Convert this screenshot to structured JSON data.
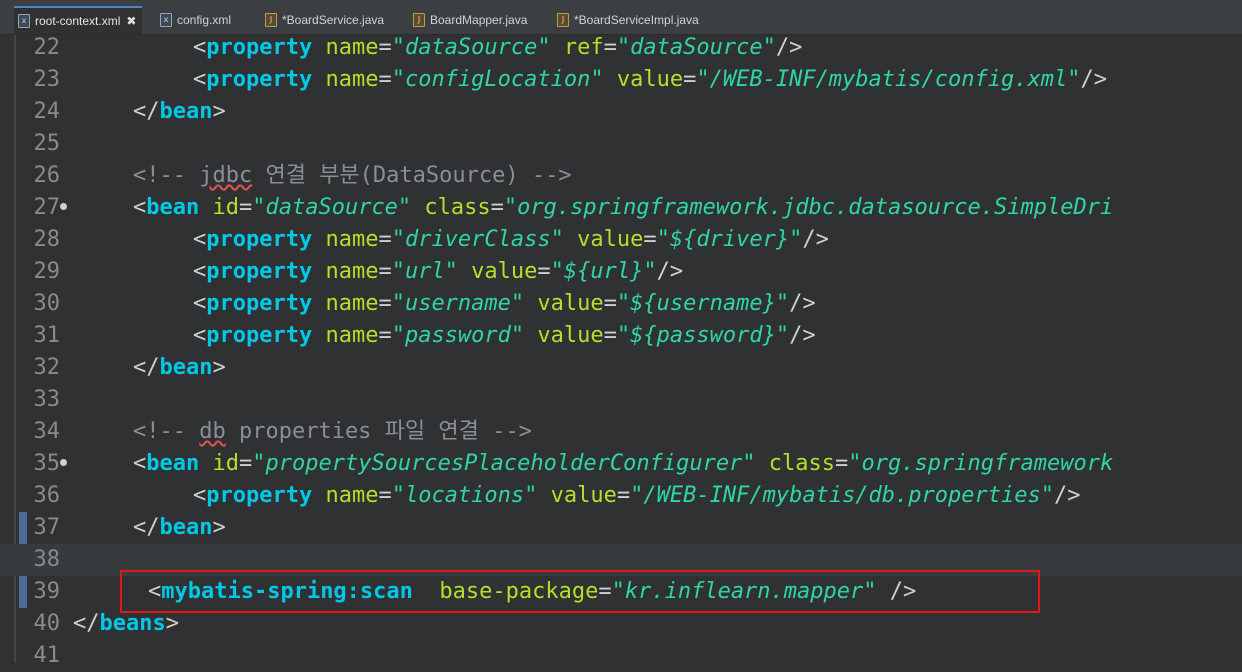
{
  "tabs": [
    {
      "label": "root-context.xml",
      "type": "xml",
      "active": true,
      "close": "✖"
    },
    {
      "label": "config.xml",
      "type": "xml"
    },
    {
      "label": "*BoardService.java",
      "type": "java"
    },
    {
      "label": "BoardMapper.java",
      "type": "java"
    },
    {
      "label": "*BoardServiceImpl.java",
      "type": "java"
    }
  ],
  "line_numbers": [
    "22",
    "23",
    "24",
    "25",
    "26",
    "27",
    "28",
    "29",
    "30",
    "31",
    "32",
    "33",
    "34",
    "35",
    "36",
    "37",
    "38",
    "39",
    "40",
    "41"
  ],
  "code": {
    "l22": {
      "p1": "<",
      "t": "property",
      "a1": " name",
      "e1": "=",
      "v1": "\"dataSource\"",
      "a2": " ref",
      "e2": "=",
      "v2": "\"dataSource\"",
      "p2": "/>"
    },
    "l23": {
      "p1": "<",
      "t": "property",
      "a1": " name",
      "e1": "=",
      "v1": "\"configLocation\"",
      "a2": " value",
      "e2": "=",
      "v2": "\"/WEB-INF/mybatis/config.xml\"",
      "p2": "/>"
    },
    "l24": {
      "p1": "</",
      "t": "bean",
      "p2": ">"
    },
    "l26": {
      "c1": "<!-- ",
      "sq": "jdbc",
      "c2": " 연결 부분(DataSource) -->"
    },
    "l27": {
      "p1": "<",
      "t": "bean",
      "a1": " id",
      "e1": "=",
      "v1": "\"dataSource\"",
      "a2": " class",
      "e2": "=",
      "v2": "\"org.springframework.jdbc.datasource.SimpleDri"
    },
    "l28": {
      "p1": "<",
      "t": "property",
      "a1": " name",
      "e1": "=",
      "v1": "\"driverClass\"",
      "a2": " value",
      "e2": "=",
      "v2": "\"${driver}\"",
      "p2": "/>"
    },
    "l29": {
      "p1": "<",
      "t": "property",
      "a1": " name",
      "e1": "=",
      "v1": "\"url\"",
      "a2": " value",
      "e2": "=",
      "v2": "\"${url}\"",
      "p2": "/>"
    },
    "l30": {
      "p1": "<",
      "t": "property",
      "a1": " name",
      "e1": "=",
      "v1": "\"username\"",
      "a2": " value",
      "e2": "=",
      "v2": "\"${username}\"",
      "p2": "/>"
    },
    "l31": {
      "p1": "<",
      "t": "property",
      "a1": " name",
      "e1": "=",
      "v1": "\"password\"",
      "a2": " value",
      "e2": "=",
      "v2": "\"${password}\"",
      "p2": "/>"
    },
    "l32": {
      "p1": "</",
      "t": "bean",
      "p2": ">"
    },
    "l34": {
      "c1": "<!-- ",
      "sq": "db",
      "c2": " properties 파일 연결 -->"
    },
    "l35": {
      "p1": "<",
      "t": "bean",
      "a1": " id",
      "e1": "=",
      "v1": "\"propertySourcesPlaceholderConfigurer\"",
      "a2": " class",
      "e2": "=",
      "v2": "\"org.springframework"
    },
    "l36": {
      "p1": "<",
      "t": "property",
      "a1": " name",
      "e1": "=",
      "v1": "\"locations\"",
      "a2": " value",
      "e2": "=",
      "v2": "\"/WEB-INF/mybatis/db.properties\"",
      "p2": "/>"
    },
    "l37": {
      "p1": "</",
      "t": "bean",
      "p2": ">"
    },
    "l39": {
      "p1": "<",
      "t": "mybatis-spring:scan",
      "a1": "  base-package",
      "e1": "=",
      "v1": "\"kr.inflearn.mapper\"",
      "p2": " />"
    },
    "l40": {
      "p1": "</",
      "t": "beans",
      "p2": ">"
    }
  },
  "colors": {
    "tag": "#00c8e6",
    "attribute": "#b3e028",
    "value": "#2fd6a3",
    "comment": "#8a8f96",
    "highlight_box": "#e01818"
  }
}
